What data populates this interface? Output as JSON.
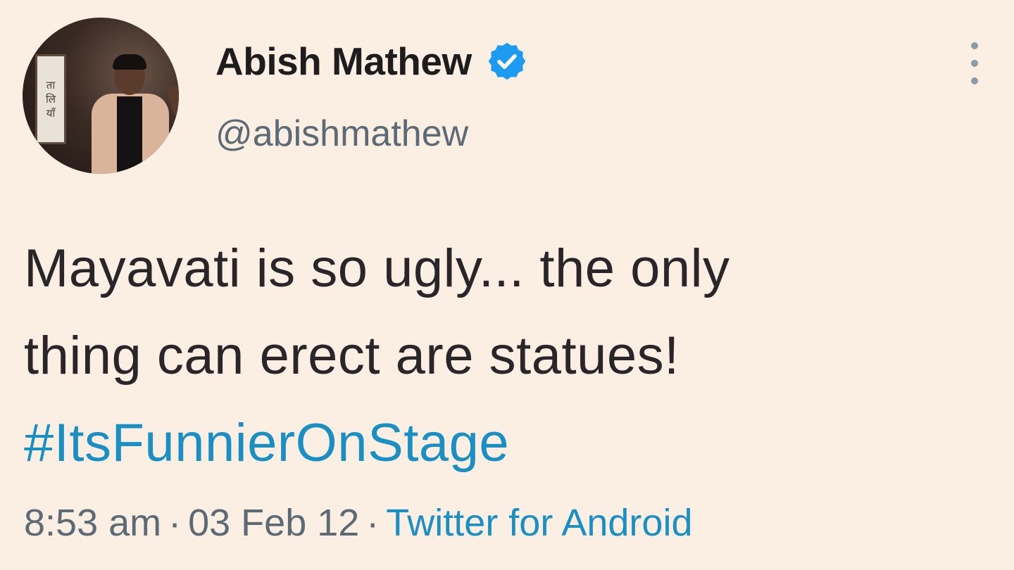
{
  "author": {
    "display_name": "Abish Mathew",
    "handle": "@abishmathew",
    "verified": true,
    "avatar_panel_text": [
      "ता",
      "लि",
      "याँ"
    ]
  },
  "tweet": {
    "text_lines": [
      "Mayavati is so ugly... the only",
      "thing can erect are statues!"
    ],
    "hashtag": "#ItsFunnierOnStage"
  },
  "meta": {
    "time": "8:53 am",
    "separator": "·",
    "date": "03 Feb 12",
    "source": "Twitter for Android"
  },
  "colors": {
    "background": "#fbeee2",
    "link": "#1a8fc4",
    "verified_badge": "#1d9bf0",
    "secondary_text": "#5b6a74"
  },
  "icons": {
    "verified": "verified-badge-icon",
    "more": "more-options-icon"
  }
}
